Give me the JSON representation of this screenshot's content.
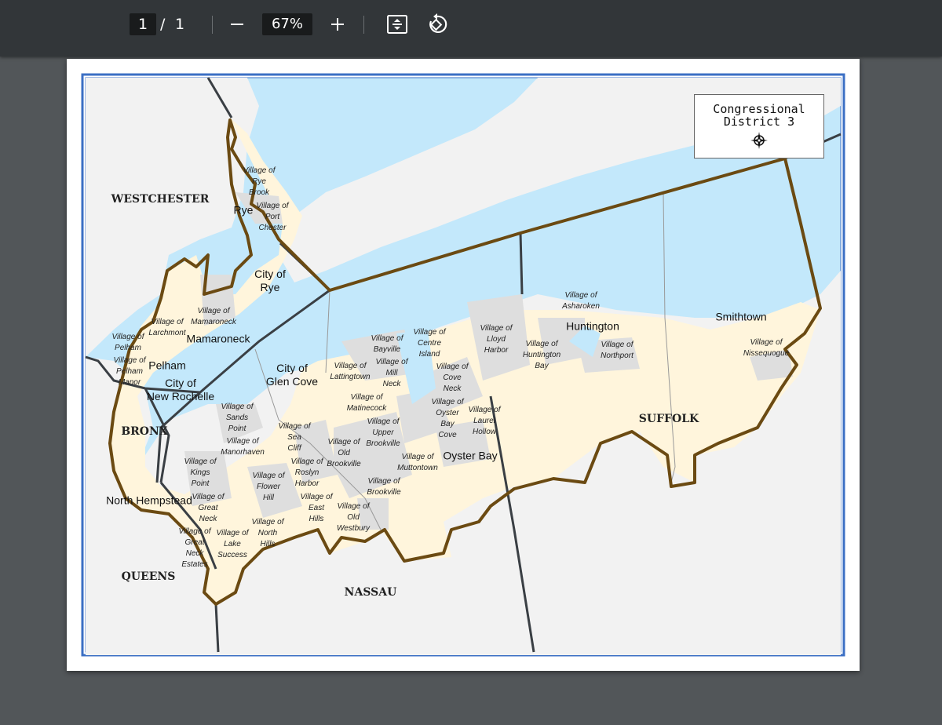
{
  "toolbar": {
    "current_page": "1",
    "page_separator": "/",
    "total_pages": "1",
    "zoom": "67%",
    "zoom_out_icon": "minus-icon",
    "zoom_in_icon": "plus-icon",
    "fit_page_icon": "fit-page-icon",
    "rotate_icon": "rotate-icon"
  },
  "map": {
    "legend_title": "Congressional\nDistrict 3",
    "legend_icon": "compass-rose-icon",
    "colors": {
      "water": "#c3e8fb",
      "district": "#fff5dc",
      "village": "#dedede",
      "land": "#f2f2f2",
      "district_border": "#6b4a12",
      "county_border": "#3a3f44",
      "frame": "#3b6fc4"
    },
    "counties": [
      "WESTCHESTER",
      "BRONX",
      "QUEENS",
      "NASSAU",
      "SUFFOLK"
    ],
    "cities": {
      "rye": "Rye",
      "city_of_rye": "City of\nRye",
      "mamaroneck": "Mamaroneck",
      "pelham": "Pelham",
      "new_rochelle": "City of\nNew Rochelle",
      "glen_cove": "City of\nGlen Cove",
      "north_hempstead": "North Hempstead",
      "oyster_bay": "Oyster Bay",
      "huntington": "Huntington",
      "smithtown": "Smithtown"
    },
    "villages": {
      "rye_brook": "Village of\nRye\nBrook",
      "port_chester": "Village of\nPort\nChester",
      "mamaroneck": "Village of\nMamaroneck",
      "larchmont": "Village of\nLarchmont",
      "pelham": "Village of\nPelham",
      "pelham_manor": "Village of\nPelham\nManor",
      "sands_point": "Village of\nSands\nPoint",
      "manorhaven": "Village of\nManorhaven",
      "kings_point": "Village of\nKings\nPoint",
      "great_neck": "Village of\nGreat\nNeck",
      "great_neck_estates": "Village of\nGreat\nNeck\nEstates",
      "lake_success": "Village of\nLake\nSuccess",
      "flower_hill": "Village of\nFlower\nHill",
      "north_hills": "Village of\nNorth\nHills",
      "sea_cliff": "Village of\nSea\nCliff",
      "roslyn_harbor": "Village of\nRoslyn\nHarbor",
      "east_hills": "Village of\nEast\nHills",
      "old_westbury": "Village of\nOld\nWestbury",
      "old_brookville": "Village of\nOld\nBrookville",
      "upper_brookville": "Village of\nUpper\nBrookville",
      "matinecock": "Village of\nMatinecock",
      "lattingtown": "Village of\nLattingtown",
      "bayville": "Village of\nBayville",
      "centre_island": "Village of\nCentre\nIsland",
      "mill_neck": "Village of\nMill\nNeck",
      "cove_neck": "Village of\nCove\nNeck",
      "oyster_bay_cove": "Village of\nOyster\nBay\nCove",
      "laurel_hollow": "Village of\nLaurel\nHollow",
      "muttontown": "Village of\nMuttontown",
      "brookville": "Village of\nBrookville",
      "lloyd_harbor": "Village of\nLloyd\nHarbor",
      "huntington_bay": "Village of\nHuntington\nBay",
      "asharoken": "Village of\nAsharoken",
      "northport": "Village of\nNorthport",
      "nissequogue": "Village of\nNissequogue"
    }
  }
}
